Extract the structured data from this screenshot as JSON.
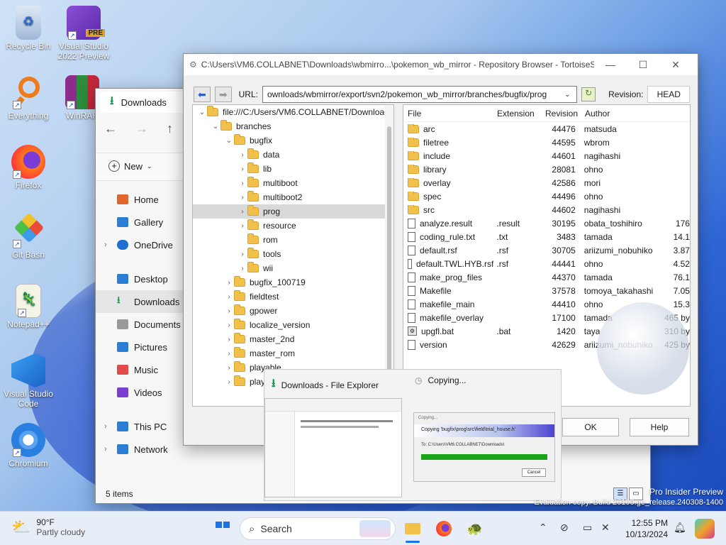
{
  "desktop": {
    "icons": [
      {
        "label": "Recycle Bin",
        "icon": "recycle-bin-icon"
      },
      {
        "label": "Visual Studio 2022 Preview",
        "badge": "PRE",
        "icon": "visual-studio-preview-icon"
      },
      {
        "label": "Everything",
        "icon": "everything-search-icon"
      },
      {
        "label": "WinRAR",
        "icon": "winrar-icon"
      },
      {
        "label": "Firefox",
        "icon": "firefox-icon"
      },
      {
        "label": "Git Bash",
        "icon": "git-bash-icon"
      },
      {
        "label": "Notepad++",
        "icon": "notepad-plus-plus-icon"
      },
      {
        "label": "Visual Studio Code",
        "icon": "vscode-icon"
      },
      {
        "label": "Chromium",
        "icon": "chromium-icon"
      }
    ],
    "watermark_line1": "Pro Insider Preview",
    "watermark_line2": "Evaluation copy. Build 26100.ge_release.240308-1400"
  },
  "explorer": {
    "tab_title": "Downloads",
    "new_label": "New",
    "sidebar": [
      {
        "label": "Home",
        "icon": "home-icon",
        "color": "#e0662b"
      },
      {
        "label": "Gallery",
        "icon": "gallery-icon",
        "color": "#2a7fd4"
      },
      {
        "label": "OneDrive",
        "icon": "onedrive-icon",
        "color": "#1f6fd1"
      },
      {
        "label": "Desktop",
        "icon": "desktop-icon",
        "color": "#2a7fd4"
      },
      {
        "label": "Downloads",
        "icon": "downloads-icon",
        "color": "#1a9a52"
      },
      {
        "label": "Documents",
        "icon": "documents-icon",
        "color": "#7a7a7a"
      },
      {
        "label": "Pictures",
        "icon": "pictures-icon",
        "color": "#2a7fd4"
      },
      {
        "label": "Music",
        "icon": "music-icon",
        "color": "#e04a4a"
      },
      {
        "label": "Videos",
        "icon": "videos-icon",
        "color": "#7a3fd1"
      },
      {
        "label": "This PC",
        "icon": "this-pc-icon",
        "color": "#2a7fd4"
      },
      {
        "label": "Network",
        "icon": "network-icon",
        "color": "#2a7fd4"
      }
    ],
    "status": "5 items"
  },
  "repo": {
    "title": "C:\\Users\\VM6.COLLABNET\\Downloads\\wbmirro...\\pokemon_wb_mirror - Repository Browser - TortoiseS...",
    "url_label": "URL:",
    "url_value": "ownloads/wbmirror/export/svn2/pokemon_wb_mirror/branches/bugfix/prog",
    "revision_label": "Revision:",
    "revision_value": "HEAD",
    "tree": [
      {
        "label": "file:///C:/Users/VM6.COLLABNET/Download",
        "depth": 0,
        "arrow": "v"
      },
      {
        "label": "branches",
        "depth": 1,
        "arrow": "v"
      },
      {
        "label": "bugfix",
        "depth": 2,
        "arrow": "v"
      },
      {
        "label": "data",
        "depth": 3,
        "arrow": ">"
      },
      {
        "label": "lib",
        "depth": 3,
        "arrow": ">"
      },
      {
        "label": "multiboot",
        "depth": 3,
        "arrow": ">"
      },
      {
        "label": "multiboot2",
        "depth": 3,
        "arrow": ">"
      },
      {
        "label": "prog",
        "depth": 3,
        "arrow": ">",
        "selected": true
      },
      {
        "label": "resource",
        "depth": 3,
        "arrow": ">"
      },
      {
        "label": "rom",
        "depth": 3,
        "arrow": ""
      },
      {
        "label": "tools",
        "depth": 3,
        "arrow": ">"
      },
      {
        "label": "wii",
        "depth": 3,
        "arrow": ">"
      },
      {
        "label": "bugfix_100719",
        "depth": 2,
        "arrow": ">"
      },
      {
        "label": "fieldtest",
        "depth": 2,
        "arrow": ">"
      },
      {
        "label": "gpower",
        "depth": 2,
        "arrow": ">"
      },
      {
        "label": "localize_version",
        "depth": 2,
        "arrow": ">"
      },
      {
        "label": "master_2nd",
        "depth": 2,
        "arrow": ">"
      },
      {
        "label": "master_rom",
        "depth": 2,
        "arrow": ">"
      },
      {
        "label": "playable",
        "depth": 2,
        "arrow": ">"
      },
      {
        "label": "play",
        "depth": 2,
        "arrow": ">"
      }
    ],
    "columns": {
      "file": "File",
      "extension": "Extension",
      "revision": "Revision",
      "author": "Author"
    },
    "files": [
      {
        "name": "arc",
        "ext": "",
        "rev": "44476",
        "author": "matsuda",
        "size": "",
        "kind": "folder"
      },
      {
        "name": "filetree",
        "ext": "",
        "rev": "44595",
        "author": "wbrom",
        "size": "",
        "kind": "folder"
      },
      {
        "name": "include",
        "ext": "",
        "rev": "44601",
        "author": "nagihashi",
        "size": "",
        "kind": "folder"
      },
      {
        "name": "library",
        "ext": "",
        "rev": "28081",
        "author": "ohno",
        "size": "",
        "kind": "folder"
      },
      {
        "name": "overlay",
        "ext": "",
        "rev": "42586",
        "author": "mori",
        "size": "",
        "kind": "folder"
      },
      {
        "name": "spec",
        "ext": "",
        "rev": "44496",
        "author": "ohno",
        "size": "",
        "kind": "folder"
      },
      {
        "name": "src",
        "ext": "",
        "rev": "44602",
        "author": "nagihashi",
        "size": "",
        "kind": "folder"
      },
      {
        "name": "analyze.result",
        "ext": ".result",
        "rev": "30195",
        "author": "obata_toshihiro",
        "size": "176",
        "kind": "file"
      },
      {
        "name": "coding_rule.txt",
        "ext": ".txt",
        "rev": "3483",
        "author": "tamada",
        "size": "14.1",
        "kind": "file"
      },
      {
        "name": "default.rsf",
        "ext": ".rsf",
        "rev": "30705",
        "author": "ariizumi_nobuhiko",
        "size": "3.87",
        "kind": "file"
      },
      {
        "name": "default.TWL.HYB.rsf",
        "ext": ".rsf",
        "rev": "44441",
        "author": "ohno",
        "size": "4.52",
        "kind": "file"
      },
      {
        "name": "make_prog_files",
        "ext": "",
        "rev": "44370",
        "author": "tamada",
        "size": "76.1",
        "kind": "file"
      },
      {
        "name": "Makefile",
        "ext": "",
        "rev": "37578",
        "author": "tomoya_takahashi",
        "size": "7.05",
        "kind": "file"
      },
      {
        "name": "makefile_main",
        "ext": "",
        "rev": "44410",
        "author": "ohno",
        "size": "15.3",
        "kind": "file"
      },
      {
        "name": "makefile_overlay",
        "ext": "",
        "rev": "17100",
        "author": "tamada",
        "size": "465 by",
        "kind": "file"
      },
      {
        "name": "upgfl.bat",
        "ext": ".bat",
        "rev": "1420",
        "author": "taya",
        "size": "310 by",
        "kind": "bat"
      },
      {
        "name": "version",
        "ext": "",
        "rev": "42629",
        "author": "ariizumi_nobuhiko",
        "size": "425 by",
        "kind": "file"
      }
    ],
    "ok_label": "OK",
    "help_label": "Help"
  },
  "thumbnails": {
    "explorer_title": "Downloads - File Explorer",
    "copy_title": "Copying...",
    "copy_dialog_title": "Copying...",
    "copy_message": "Copying 'bugfix\\prog\\src\\field\\trial_house.h'",
    "copy_to": "To: C:\\Users\\VM6.COLLABNET\\Downloads\\",
    "copy_cancel": "Cancel",
    "copy_progress": 1.0
  },
  "taskbar": {
    "weather_temp": "90°F",
    "weather_desc": "Partly cloudy",
    "search_label": "Search",
    "time": "12:55 PM",
    "date": "10/13/2024"
  }
}
